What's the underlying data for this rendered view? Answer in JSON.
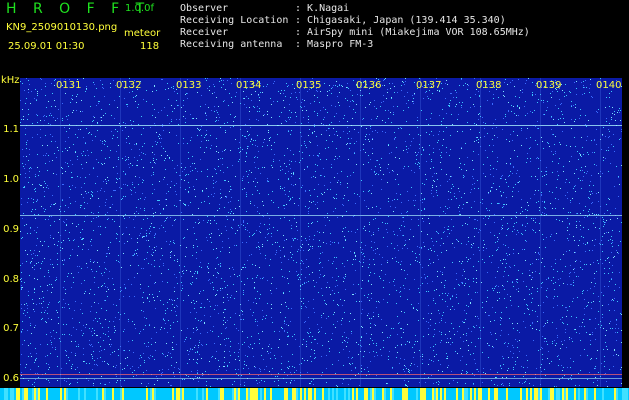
{
  "header": {
    "title": "H R O F F T",
    "version": "1.0.0f",
    "filename": "KN9_2509010130.png",
    "mode": "meteor",
    "datetime": "25.09.01 01:30",
    "count": "118"
  },
  "info": [
    {
      "label": "Observer",
      "value": "K.Nagai"
    },
    {
      "label": "Receiving Location",
      "value": "Chigasaki, Japan (139.414 35.340)"
    },
    {
      "label": "Receiver",
      "value": "AirSpy mini (Miakejima VOR 108.65MHz)"
    },
    {
      "label": "Receiving antenna",
      "value": "Maspro FM-3"
    }
  ],
  "axis": {
    "unit": "kHz",
    "y_ticks": [
      "1.1",
      "1.0",
      "0.9",
      "0.8",
      "0.7",
      "0.6"
    ],
    "x_ticks": [
      "0131",
      "0132",
      "0133",
      "0134",
      "0135",
      "0136",
      "0137",
      "0138",
      "0139",
      "0140"
    ]
  },
  "colors": {
    "background": "#0a1aa5",
    "noise_cyan": "#3cc6ff",
    "noise_blue": "#3a6bff",
    "label_yellow": "#ffff3a",
    "title_green": "#1fe21f",
    "carrier_line": "#a8f0ff"
  }
}
